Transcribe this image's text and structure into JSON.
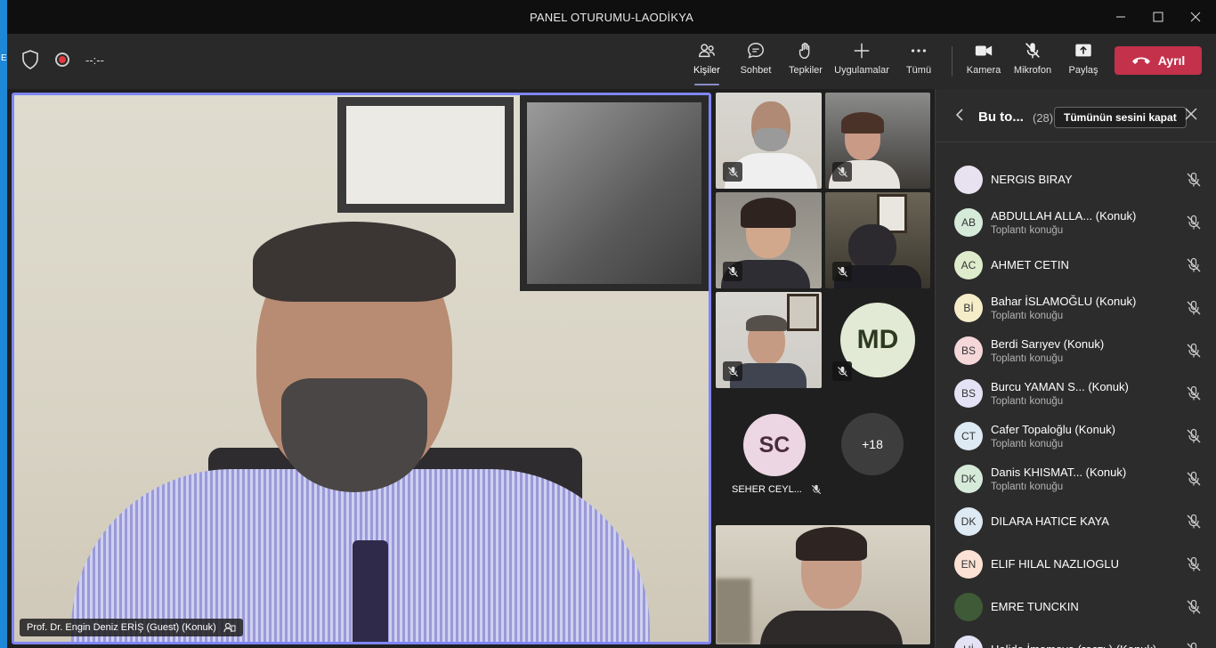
{
  "window": {
    "title": "PANEL OTURUMU-LAODİKYA"
  },
  "desktop": {
    "edge_letter": "E"
  },
  "toolbar": {
    "timer": "--:--",
    "buttons": [
      {
        "label": "Kişiler",
        "icon": "people-icon"
      },
      {
        "label": "Sohbet",
        "icon": "chat-icon"
      },
      {
        "label": "Tepkiler",
        "icon": "reaction-hand-icon"
      },
      {
        "label": "Uygulamalar",
        "icon": "plus-icon"
      },
      {
        "label": "Tümü",
        "icon": "more-icon"
      },
      {
        "label": "Kamera",
        "icon": "camera-icon"
      },
      {
        "label": "Mikrofon",
        "icon": "mic-off-icon"
      },
      {
        "label": "Paylaş",
        "icon": "share-icon"
      }
    ],
    "leave_label": "Ayrıl"
  },
  "stage": {
    "main_name": "Prof. Dr. Engin Deniz ERİŞ (Guest) (Konuk)",
    "md_initials": "MD",
    "sc_initials": "SC",
    "sc_name": "SEHER CEYL...",
    "overflow_count": "+18"
  },
  "panel": {
    "title": "Bu to...",
    "count": "(28)",
    "mute_all_label": "Tümünün sesini kapat",
    "participants": [
      {
        "initials": "",
        "name": "NERGIS BIRAY",
        "sub": "",
        "color": "#e8e2f0"
      },
      {
        "initials": "AB",
        "name": "ABDULLAH ALLA... (Konuk)",
        "sub": "Toplantı konuğu",
        "color": "#d6ead9"
      },
      {
        "initials": "AC",
        "name": "AHMET CETIN",
        "sub": "",
        "color": "#dfeccc"
      },
      {
        "initials": "Bİ",
        "name": "Bahar İSLAMOĞLU (Konuk)",
        "sub": "Toplantı konuğu",
        "color": "#f5edc8"
      },
      {
        "initials": "BS",
        "name": "Berdi Sarıyev (Konuk)",
        "sub": "Toplantı konuğu",
        "color": "#f5d7d9"
      },
      {
        "initials": "BS",
        "name": "Burcu YAMAN S...  (Konuk)",
        "sub": "Toplantı konuğu",
        "color": "#e3e3f5"
      },
      {
        "initials": "CT",
        "name": "Cafer Topaloğlu (Konuk)",
        "sub": "Toplantı konuğu",
        "color": "#dde9f3"
      },
      {
        "initials": "DK",
        "name": "Danis KHISMAT...  (Konuk)",
        "sub": "Toplantı konuğu",
        "color": "#d6ead9"
      },
      {
        "initials": "DK",
        "name": "DILARA HATICE KAYA",
        "sub": "",
        "color": "#dde9f3"
      },
      {
        "initials": "EN",
        "name": "ELIF HILAL NAZLIOGLU",
        "sub": "",
        "color": "#fbe2d5"
      },
      {
        "initials": "",
        "name": "EMRE TUNCKIN",
        "sub": "",
        "color": "#3f5a36"
      },
      {
        "initials": "Hİ",
        "name": "Halide İmamova (гость) (Konuk)",
        "sub": "",
        "color": "#e3e3f5"
      }
    ]
  }
}
